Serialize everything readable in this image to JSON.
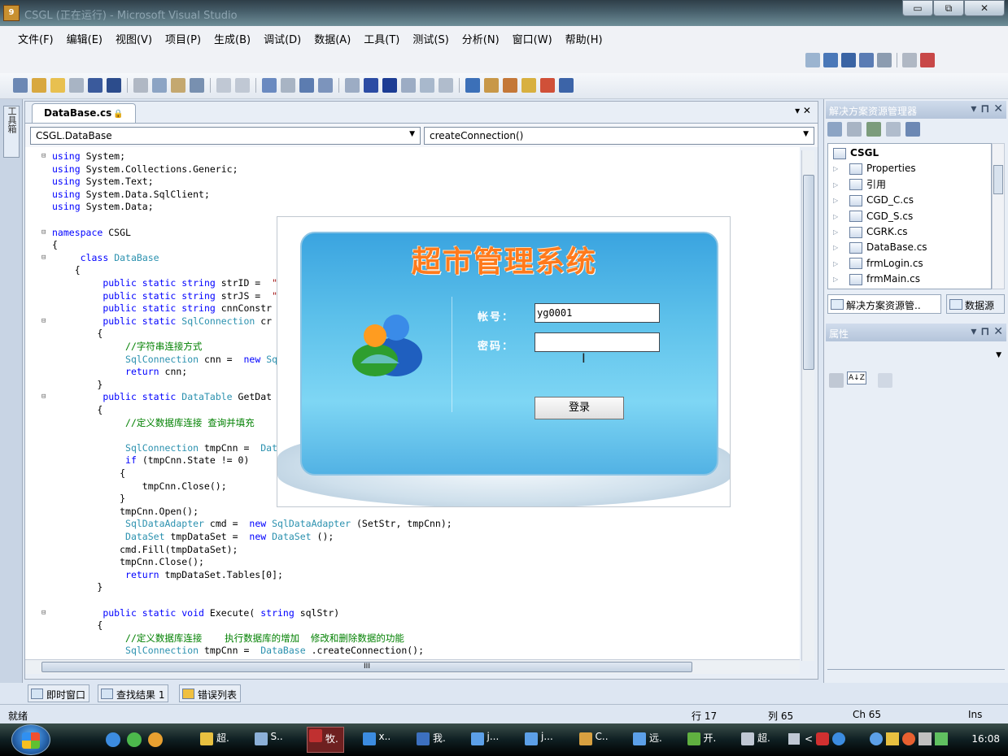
{
  "window": {
    "title": "CSGL (正在运行) - Microsoft Visual Studio",
    "buttons": {
      "minimize": "▭",
      "restore": "⧉",
      "close": "✕"
    }
  },
  "menu": [
    "文件(F)",
    "编辑(E)",
    "视图(V)",
    "项目(P)",
    "生成(B)",
    "调试(D)",
    "数据(A)",
    "工具(T)",
    "测试(S)",
    "分析(N)",
    "窗口(W)",
    "帮助(H)"
  ],
  "left_toolbox": {
    "label": "工具箱"
  },
  "editor": {
    "tab": "DataBase.cs",
    "lock": "🔒",
    "tab_controls": "▾  ✕",
    "class_combo": "CSGL.DataBase",
    "member_combo": "createConnection()",
    "hscroll_label": "III",
    "lines": [
      {
        "g": "⊟",
        "parts": [
          [
            "kw",
            "using"
          ],
          [
            "",
            "System;"
          ]
        ]
      },
      {
        "g": "",
        "parts": [
          [
            "kw",
            "using"
          ],
          [
            "",
            "System.Collections.Generic;"
          ]
        ]
      },
      {
        "g": "",
        "parts": [
          [
            "kw",
            "using"
          ],
          [
            "",
            "System.Text;"
          ]
        ]
      },
      {
        "g": "",
        "parts": [
          [
            "kw",
            "using"
          ],
          [
            "",
            "System.Data.SqlClient;"
          ]
        ]
      },
      {
        "g": "",
        "parts": [
          [
            "kw",
            "using"
          ],
          [
            "",
            "System.Data;"
          ]
        ]
      },
      {
        "g": "",
        "parts": []
      },
      {
        "g": "⊟",
        "parts": [
          [
            "kw",
            "namespace"
          ],
          [
            "",
            "CSGL"
          ]
        ]
      },
      {
        "g": "",
        "parts": [
          [
            "",
            "{"
          ]
        ]
      },
      {
        "g": "⊟",
        "parts": [
          [
            "",
            "    "
          ],
          [
            "kw",
            "class"
          ],
          [
            "ty",
            "DataBase"
          ]
        ]
      },
      {
        "g": "",
        "parts": [
          [
            "",
            "    {"
          ]
        ]
      },
      {
        "g": "",
        "parts": [
          [
            "",
            "        "
          ],
          [
            "kw",
            "public static string"
          ],
          [
            "",
            "strID = "
          ],
          [
            "st",
            "\""
          ]
        ]
      },
      {
        "g": "",
        "parts": [
          [
            "",
            "        "
          ],
          [
            "kw",
            "public static string"
          ],
          [
            "",
            "strJS = "
          ],
          [
            "st",
            "\""
          ]
        ]
      },
      {
        "g": "",
        "parts": [
          [
            "",
            "        "
          ],
          [
            "kw",
            "public static string"
          ],
          [
            "",
            "cnnConstr"
          ]
        ]
      },
      {
        "g": "⊟",
        "parts": [
          [
            "",
            "        "
          ],
          [
            "kw",
            "public static"
          ],
          [
            "ty",
            "SqlConnection"
          ],
          [
            "",
            "cr"
          ]
        ]
      },
      {
        "g": "",
        "parts": [
          [
            "",
            "        {"
          ]
        ]
      },
      {
        "g": "",
        "parts": [
          [
            "",
            "            "
          ],
          [
            "cm",
            "//字符串连接方式"
          ]
        ]
      },
      {
        "g": "",
        "parts": [
          [
            "",
            "            "
          ],
          [
            "ty",
            "SqlConnection"
          ],
          [
            "",
            "cnn = "
          ],
          [
            "kw",
            "new"
          ],
          [
            "ty",
            "Sq"
          ]
        ]
      },
      {
        "g": "",
        "parts": [
          [
            "",
            "            "
          ],
          [
            "kw",
            "return"
          ],
          [
            "",
            "cnn;"
          ]
        ]
      },
      {
        "g": "",
        "parts": [
          [
            "",
            "        }"
          ]
        ]
      },
      {
        "g": "⊟",
        "parts": [
          [
            "",
            "        "
          ],
          [
            "kw",
            "public static"
          ],
          [
            "ty",
            "DataTable"
          ],
          [
            "",
            "GetDat"
          ]
        ]
      },
      {
        "g": "",
        "parts": [
          [
            "",
            "        {"
          ]
        ]
      },
      {
        "g": "",
        "parts": [
          [
            "",
            "            "
          ],
          [
            "cm",
            "//定义数据库连接 查询并填充"
          ]
        ]
      },
      {
        "g": "",
        "parts": []
      },
      {
        "g": "",
        "parts": [
          [
            "",
            "            "
          ],
          [
            "ty",
            "SqlConnection"
          ],
          [
            "",
            "tmpCnn = "
          ],
          [
            "ty",
            "Dat"
          ]
        ]
      },
      {
        "g": "",
        "parts": [
          [
            "",
            "            "
          ],
          [
            "kw",
            "if"
          ],
          [
            "",
            "(tmpCnn.State != 0)"
          ]
        ]
      },
      {
        "g": "",
        "parts": [
          [
            "",
            "            {"
          ]
        ]
      },
      {
        "g": "",
        "parts": [
          [
            "",
            "                tmpCnn.Close();"
          ]
        ]
      },
      {
        "g": "",
        "parts": [
          [
            "",
            "            }"
          ]
        ]
      },
      {
        "g": "",
        "parts": [
          [
            "",
            "            tmpCnn.Open();"
          ]
        ]
      },
      {
        "g": "",
        "parts": [
          [
            "",
            "            "
          ],
          [
            "ty",
            "SqlDataAdapter"
          ],
          [
            "",
            "cmd = "
          ],
          [
            "kw",
            "new"
          ],
          [
            "ty",
            "SqlDataAdapter"
          ],
          [
            "",
            "(SetStr, tmpCnn);"
          ]
        ]
      },
      {
        "g": "",
        "parts": [
          [
            "",
            "            "
          ],
          [
            "ty",
            "DataSet"
          ],
          [
            "",
            "tmpDataSet = "
          ],
          [
            "kw",
            "new"
          ],
          [
            "ty",
            "DataSet"
          ],
          [
            "",
            "();"
          ]
        ]
      },
      {
        "g": "",
        "parts": [
          [
            "",
            "            cmd.Fill(tmpDataSet);"
          ]
        ]
      },
      {
        "g": "",
        "parts": [
          [
            "",
            "            tmpCnn.Close();"
          ]
        ]
      },
      {
        "g": "",
        "parts": [
          [
            "",
            "            "
          ],
          [
            "kw",
            "return"
          ],
          [
            "",
            "tmpDataSet.Tables[0];"
          ]
        ]
      },
      {
        "g": "",
        "parts": [
          [
            "",
            "        }"
          ]
        ]
      },
      {
        "g": "",
        "parts": []
      },
      {
        "g": "⊟",
        "parts": [
          [
            "",
            "        "
          ],
          [
            "kw",
            "public static void"
          ],
          [
            "",
            "Execute("
          ],
          [
            "kw",
            "string"
          ],
          [
            "",
            "sqlStr)"
          ]
        ]
      },
      {
        "g": "",
        "parts": [
          [
            "",
            "        {"
          ]
        ]
      },
      {
        "g": "",
        "parts": [
          [
            "",
            "            "
          ],
          [
            "cm",
            "//定义数据库连接    执行数据库的增加  修改和删除数据的功能"
          ]
        ]
      },
      {
        "g": "",
        "parts": [
          [
            "",
            "            "
          ],
          [
            "ty",
            "SqlConnection"
          ],
          [
            "",
            "tmpCnn = "
          ],
          [
            "ty",
            "DataBase"
          ],
          [
            "",
            ".createConnection();"
          ]
        ]
      }
    ]
  },
  "login": {
    "title": "超市管理系统",
    "account_label": "帐号：",
    "account_value": "yg0001",
    "password_label": "密码：",
    "password_value": "",
    "login_button": "登录"
  },
  "solution_explorer": {
    "title": "解决方案资源管理器",
    "controls": "▾ ⊓ ✕",
    "items": [
      {
        "label": "CSGL",
        "bold": true,
        "indent": 0
      },
      {
        "label": "Properties",
        "indent": 1
      },
      {
        "label": "引用",
        "indent": 1
      },
      {
        "label": "CGD_C.cs",
        "indent": 1
      },
      {
        "label": "CGD_S.cs",
        "indent": 1
      },
      {
        "label": "CGRK.cs",
        "indent": 1
      },
      {
        "label": "DataBase.cs",
        "indent": 1
      },
      {
        "label": "frmLogin.cs",
        "indent": 1
      },
      {
        "label": "frmMain.cs",
        "indent": 1
      }
    ],
    "tab_active": "解决方案资源管..",
    "tab_other": "数据源"
  },
  "properties": {
    "title": "属性",
    "controls": "▾ ⊓ ✕",
    "sort_icon": "A↓Z"
  },
  "bottom_tabs": [
    "即时窗口",
    "查找结果 1",
    "错误列表"
  ],
  "status": {
    "ready": "就绪",
    "row": "行 17",
    "col": "列 65",
    "ch": "Ch 65",
    "mode": "Ins"
  },
  "taskbar": {
    "tasks": [
      "超.",
      "S..",
      "牧.",
      "x..",
      "我.",
      "j...",
      "j...",
      "C..",
      "远.",
      "开.",
      "超."
    ],
    "clock": "16:08"
  }
}
